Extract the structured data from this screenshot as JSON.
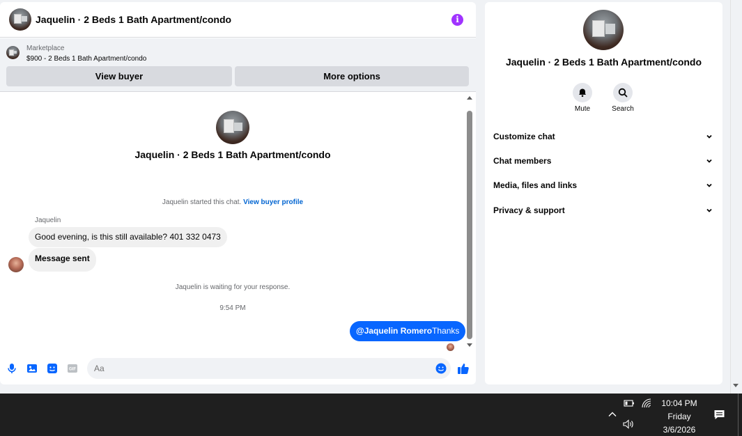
{
  "chat": {
    "title": "Jaquelin · 2 Beds 1 Bath Apartment/condo",
    "marketplace_label": "Marketplace",
    "listing": "$900 - 2 Beds 1 Bath Apartment/condo",
    "view_buyer": "View buyer",
    "more_options": "More options",
    "center_title": "Jaquelin · 2 Beds 1 Bath Apartment/condo",
    "started_text": "Jaquelin started this chat.",
    "view_profile": "View buyer profile",
    "sender_name": "Jaquelin",
    "messages_in": [
      "Good evening, is this still available? 401 332 0473",
      "Message sent"
    ],
    "waiting_text": "Jaquelin is waiting for your response.",
    "timestamp": "9:54 PM",
    "out_mention": "@Jaquelin Romero",
    "out_text": "Thanks",
    "composer_placeholder": "Aa"
  },
  "info": {
    "title": "Jaquelin · 2 Beds 1 Bath Apartment/condo",
    "mute": "Mute",
    "search": "Search",
    "sections": [
      "Customize chat",
      "Chat members",
      "Media, files and links",
      "Privacy & support"
    ]
  },
  "taskbar": {
    "time": "10:04 PM",
    "day": "Friday",
    "date": "3/6/2026"
  },
  "colors": {
    "accent": "#0866ff",
    "info": "#a033ff",
    "taskbar": "#1f1f1f"
  }
}
